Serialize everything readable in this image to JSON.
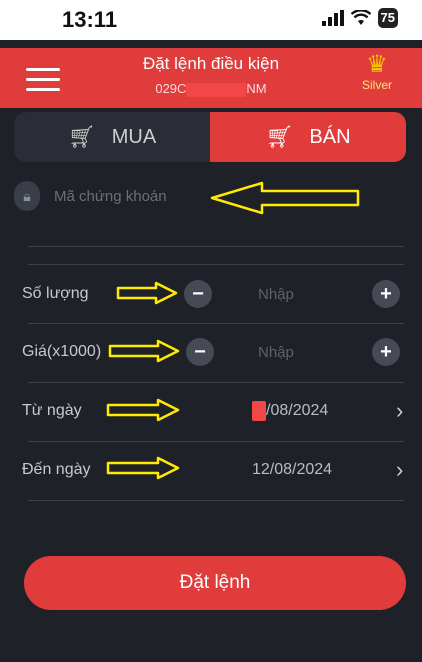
{
  "status_bar": {
    "time": "13:11",
    "battery": "75"
  },
  "header": {
    "title": "Đặt lệnh điều kiện",
    "account_prefix": "029C",
    "account_suffix": "NM",
    "tier": "Silver"
  },
  "tabs": [
    {
      "label": "MUA",
      "active": false
    },
    {
      "label": "BÁN",
      "active": true
    }
  ],
  "stock": {
    "placeholder": "Mã chứng khoán"
  },
  "quantity": {
    "label": "Số lượng",
    "placeholder": "Nhập",
    "minus": "−",
    "plus": "+"
  },
  "price": {
    "label": "Giá(x1000)",
    "placeholder": "Nhập",
    "minus": "−",
    "plus": "+"
  },
  "from_date": {
    "label": "Từ ngày",
    "value": "/08/2024"
  },
  "to_date": {
    "label": "Đến ngày",
    "value": "12/08/2024"
  },
  "chevron": "›",
  "submit": {
    "label": "Đặt lệnh"
  },
  "colors": {
    "accent": "#e03c3c",
    "background": "#1e2128",
    "annotation": "#ffeb00"
  },
  "icons": [
    "menu-icon",
    "crown-icon",
    "cart-icon",
    "lock-icon",
    "minus-icon",
    "plus-icon",
    "chevron-right-icon"
  ]
}
